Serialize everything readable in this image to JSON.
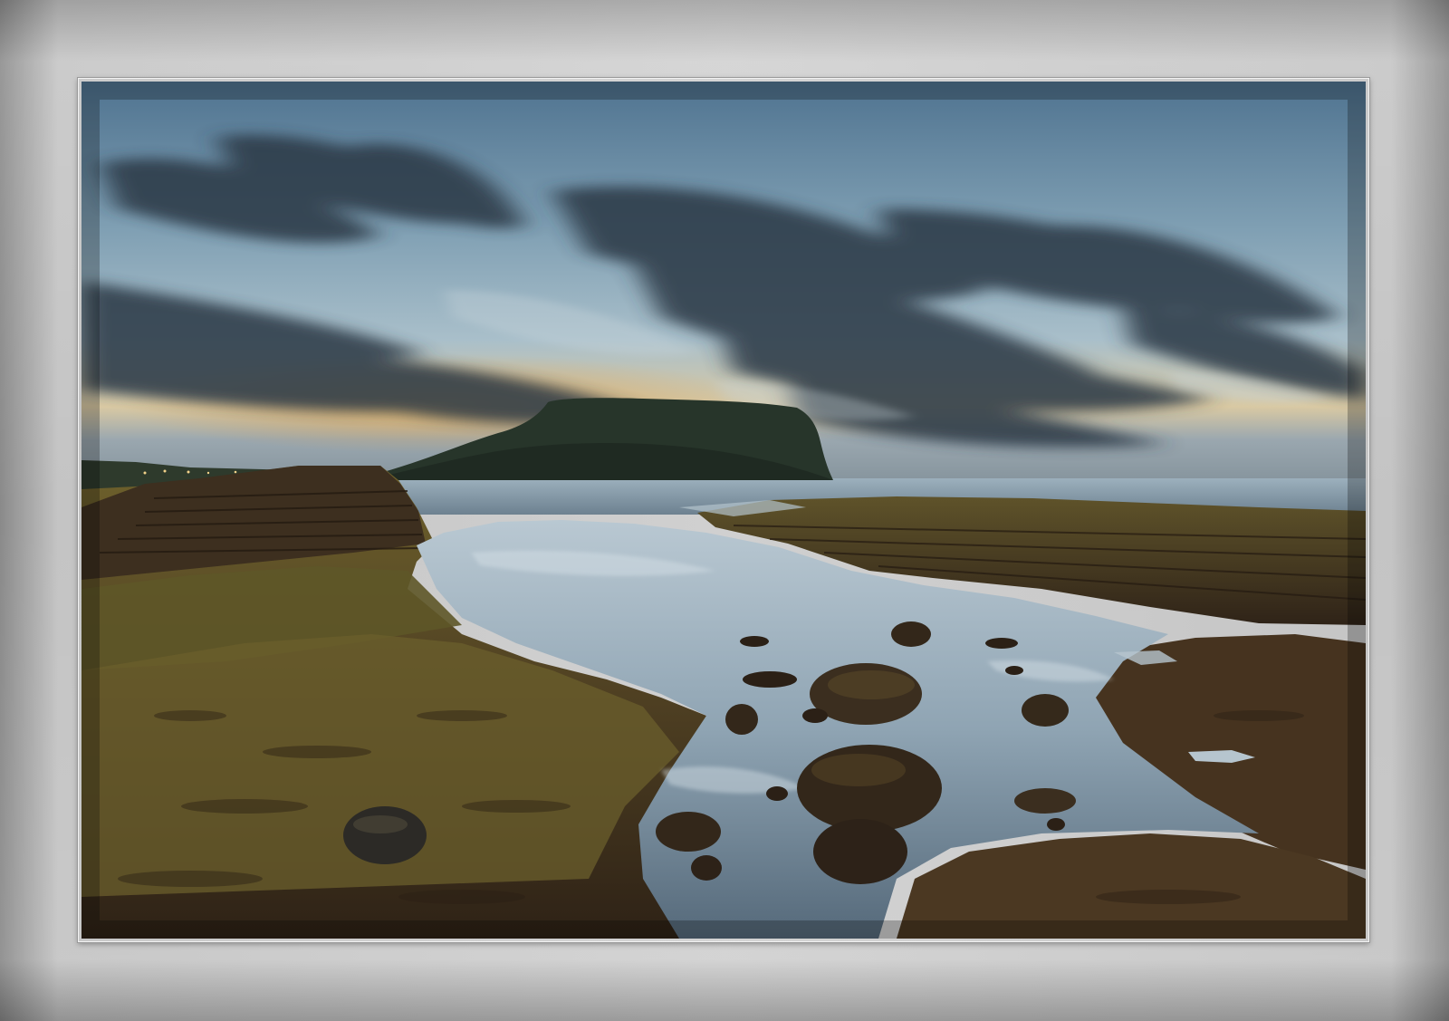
{
  "scene": {
    "palette": {
      "sky_top": "#5d7f98",
      "sky_mid": "#9fb8c6",
      "sunset_glow": "#e8b56a",
      "cloud_dark": "#2c3a46",
      "sea": "#8fa3b0",
      "rock_moss": "#6b5d2a",
      "rock_dark": "#3a2c1d",
      "water_pool": "#a7b8c4",
      "mat_gray": "#c8c8c8"
    }
  }
}
